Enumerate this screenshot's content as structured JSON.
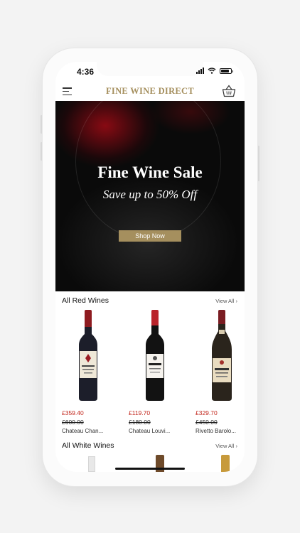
{
  "status_bar": {
    "time": "4:36"
  },
  "header": {
    "logo_text": "FINE WINE DIRECT",
    "menu_icon": "menu-icon",
    "basket_icon": "basket-icon"
  },
  "hero": {
    "title": "Fine Wine Sale",
    "subtitle": "Save up to 50% Off",
    "button_label": "Shop Now"
  },
  "sections": [
    {
      "title": "All Red Wines",
      "view_all_label": "View All",
      "products": [
        {
          "price": "£359.40",
          "original_price": "£600.00",
          "name": "Chateau Chan..."
        },
        {
          "price": "£119.70",
          "original_price": "£180.00",
          "name": "Chateau Louvi..."
        },
        {
          "price": "£329.70",
          "original_price": "£450.00",
          "name": "Rivetto Barolo..."
        }
      ]
    },
    {
      "title": "All White Wines",
      "view_all_label": "View All"
    }
  ],
  "colors": {
    "brand_gold": "#a58f5e",
    "sale_red": "#c2261c",
    "text_dark": "#111111"
  }
}
